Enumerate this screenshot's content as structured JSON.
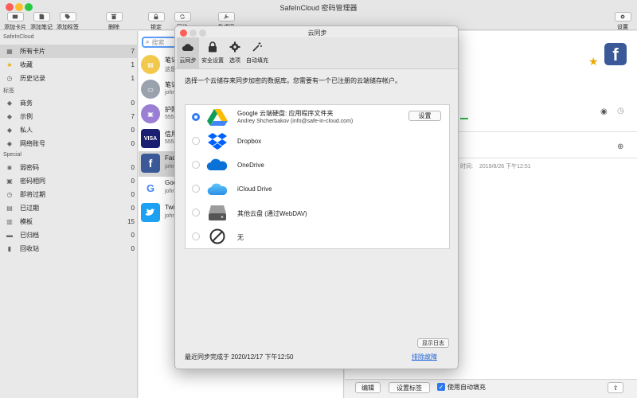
{
  "window": {
    "title": "SafeInCloud 密码管理器"
  },
  "toolbar": {
    "add_card": "添加卡片",
    "add_note": "添加笔记",
    "add_label": "添加标签",
    "delete": "删除",
    "lock": "锁定",
    "sync": "同步",
    "generator": "生成器",
    "settings": "设置"
  },
  "sidebar": {
    "header": "SafeInCloud",
    "items": [
      {
        "label": "所有卡片",
        "count": "7"
      },
      {
        "label": "收藏",
        "count": "1"
      },
      {
        "label": "历史记录",
        "count": "1"
      }
    ],
    "labels_header": "标签",
    "labels": [
      {
        "label": "商务",
        "count": "0"
      },
      {
        "label": "示例",
        "count": "7"
      },
      {
        "label": "私人",
        "count": "0"
      },
      {
        "label": "网络账号",
        "count": "0"
      }
    ],
    "special_header": "Special",
    "special": [
      {
        "label": "弱密码",
        "count": "0"
      },
      {
        "label": "密码相同",
        "count": "0"
      },
      {
        "label": "即将过期",
        "count": "0"
      },
      {
        "label": "已过期",
        "count": "0"
      },
      {
        "label": "模板",
        "count": "15"
      },
      {
        "label": "已归档",
        "count": "0"
      },
      {
        "label": "回收站",
        "count": "0"
      }
    ]
  },
  "list": {
    "search_placeholder": "搜索",
    "items": [
      {
        "title": "笔记",
        "subtitle": "这是"
      },
      {
        "title": "笔记",
        "subtitle": "john"
      },
      {
        "title": "护照",
        "subtitle": "555"
      },
      {
        "title": "信用",
        "subtitle": "555"
      },
      {
        "title": "Face",
        "subtitle": "john"
      },
      {
        "title": "Goo",
        "subtitle": "john"
      },
      {
        "title": "Twi",
        "subtitle": "john"
      }
    ]
  },
  "detail": {
    "modified_label": "时间:",
    "modified_value": "2019/8/26 下午12:51",
    "edit_button": "编辑",
    "set_labels_button": "设置标签",
    "autofill_label": "使用自动填充"
  },
  "dialog": {
    "title": "云同步",
    "tabs": [
      {
        "label": "云同步",
        "icon": "cloud-icon"
      },
      {
        "label": "安全设置",
        "icon": "lock-icon"
      },
      {
        "label": "选项",
        "icon": "gear-icon"
      },
      {
        "label": "自动填充",
        "icon": "magic-wand-icon"
      }
    ],
    "prompt": "选择一个云储存来同步加密的数据库。您需要有一个已注册的云端储存帐户。",
    "providers": [
      {
        "name": "Google 云端硬盘: 应用程序文件夹",
        "account": "Andrey Shcherbakov (info@safe-in-cloud.com)",
        "selected": true,
        "icon": "google-drive-icon"
      },
      {
        "name": "Dropbox",
        "selected": false,
        "icon": "dropbox-icon"
      },
      {
        "name": "OneDrive",
        "selected": false,
        "icon": "onedrive-icon"
      },
      {
        "name": "iCloud Drive",
        "selected": false,
        "icon": "icloud-icon"
      },
      {
        "name": "其他云盘 (通过WebDAV)",
        "selected": false,
        "icon": "webdav-drive-icon"
      },
      {
        "name": "无",
        "selected": false,
        "icon": "none-icon"
      }
    ],
    "settings_button": "设置",
    "show_log_button": "显示日志",
    "last_sync": "最近同步完成于 2020/12/17 下午12:50",
    "troubleshoot_link": "排除故障"
  },
  "colors": {
    "accent_blue": "#2f7bf5",
    "link_blue": "#1a5fd6",
    "star_gold": "#e8a900",
    "facebook_blue": "#3b5998",
    "twitter_blue": "#1da1f2",
    "visa_blue": "#1a1f71"
  }
}
